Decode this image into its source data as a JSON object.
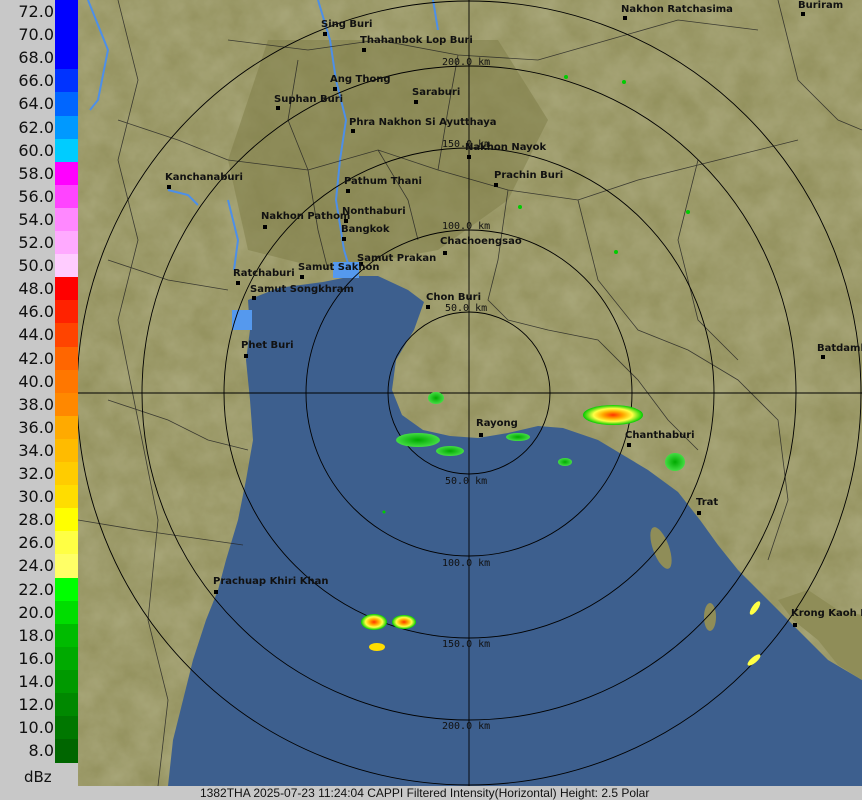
{
  "legend": {
    "unit": "dBz",
    "levels": [
      {
        "label": "72.0",
        "color": "#0000ff"
      },
      {
        "label": "70.0",
        "color": "#0000ff"
      },
      {
        "label": "68.0",
        "color": "#0000ff"
      },
      {
        "label": "66.0",
        "color": "#0033ff"
      },
      {
        "label": "64.0",
        "color": "#0066ff"
      },
      {
        "label": "62.0",
        "color": "#0099ff"
      },
      {
        "label": "60.0",
        "color": "#00ccff"
      },
      {
        "label": "58.0",
        "color": "#ff00ff"
      },
      {
        "label": "56.0",
        "color": "#ff44ff"
      },
      {
        "label": "54.0",
        "color": "#ff88ff"
      },
      {
        "label": "52.0",
        "color": "#ffaaff"
      },
      {
        "label": "50.0",
        "color": "#ffccff"
      },
      {
        "label": "48.0",
        "color": "#ff0000"
      },
      {
        "label": "46.0",
        "color": "#ff2200"
      },
      {
        "label": "44.0",
        "color": "#ff4400"
      },
      {
        "label": "42.0",
        "color": "#ff6600"
      },
      {
        "label": "40.0",
        "color": "#ff7700"
      },
      {
        "label": "38.0",
        "color": "#ff8800"
      },
      {
        "label": "36.0",
        "color": "#ffaa00"
      },
      {
        "label": "34.0",
        "color": "#ffbb00"
      },
      {
        "label": "32.0",
        "color": "#ffcc00"
      },
      {
        "label": "30.0",
        "color": "#ffdd00"
      },
      {
        "label": "28.0",
        "color": "#ffff00"
      },
      {
        "label": "26.0",
        "color": "#ffff44"
      },
      {
        "label": "24.0",
        "color": "#ffff66"
      },
      {
        "label": "22.0",
        "color": "#00ff00"
      },
      {
        "label": "20.0",
        "color": "#00dd00"
      },
      {
        "label": "18.0",
        "color": "#00bb00"
      },
      {
        "label": "16.0",
        "color": "#00aa00"
      },
      {
        "label": "14.0",
        "color": "#009900"
      },
      {
        "label": "12.0",
        "color": "#008800"
      },
      {
        "label": "10.0",
        "color": "#007700"
      },
      {
        "label": "8.0",
        "color": "#006600"
      }
    ]
  },
  "rings": {
    "label_50_n": "50.0 km",
    "label_100_n": "100.0 km",
    "label_150_n": "150.0 km",
    "label_200_n": "200.0 km",
    "label_50_s": "50.0 km",
    "label_100_s": "100.0 km",
    "label_150_s": "150.0 km",
    "label_200_s": "200.0 km"
  },
  "cities": {
    "sing_buri": "Sing Buri",
    "thahanbok": "Thahanbok Lop Buri",
    "ang_thong": "Ang Thong",
    "suphan_buri": "Suphan Buri",
    "saraburi": "Saraburi",
    "ayutthaya": "Phra Nakhon Si Ayutthaya",
    "nakhon_nayok": "Nakhon Nayok",
    "kanchanaburi": "Kanchanaburi",
    "pathum_thani": "Pathum Thani",
    "prachin_buri": "Prachin Buri",
    "nakhon_pathom": "Nakhon Pathom",
    "nonthaburi": "Nonthaburi",
    "bangkok": "Bangkok",
    "chachoengsao": "Chachoengsao",
    "samut_prakan": "Samut Prakan",
    "samut_sakhon": "Samut Sakhon",
    "ratchaburi": "Ratchaburi",
    "samut_songkhram": "Samut Songkhram",
    "chon_buri": "Chon Buri",
    "phet_buri": "Phet Buri",
    "rayong": "Rayong",
    "chanthaburi": "Chanthaburi",
    "trat": "Trat",
    "batdamb": "Batdamb",
    "prachuap": "Prachuap Khiri Khan",
    "krong_kaoh": "Krong Kaoh Ko",
    "nakhon_ratchasima": "Nakhon Ratchasima",
    "buriram": "Buriram"
  },
  "footer": {
    "caption": "1382THA 2025-07-23 11:24:04 CAPPI Filtered Intensity(Horizontal)  Height: 2.5 Polar"
  },
  "colors": {
    "sea": "#3d5f8e",
    "land": "#8f8d58",
    "land_dark": "#6f6e44",
    "river": "#4d8fe8",
    "ring": "#000000"
  }
}
